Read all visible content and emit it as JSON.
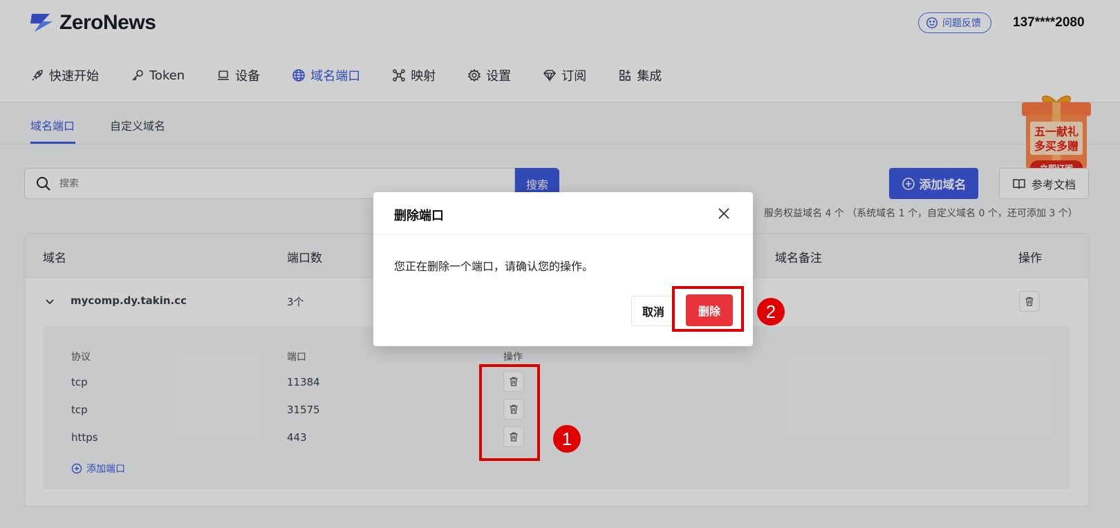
{
  "app": {
    "logo_text": "ZeroNews",
    "feedback_label": "问题反馈",
    "user_phone": "137****2080"
  },
  "nav": {
    "items": [
      {
        "label": "快速开始",
        "icon": "rocket-icon"
      },
      {
        "label": "Token",
        "icon": "key-icon"
      },
      {
        "label": "设备",
        "icon": "laptop-icon"
      },
      {
        "label": "域名端口",
        "icon": "globe-icon",
        "active": true
      },
      {
        "label": "映射",
        "icon": "network-icon"
      },
      {
        "label": "设置",
        "icon": "gear-icon"
      },
      {
        "label": "订阅",
        "icon": "diamond-icon"
      },
      {
        "label": "集成",
        "icon": "apps-icon"
      }
    ]
  },
  "subtabs": {
    "domain_ports": "域名端口",
    "custom_domain": "自定义域名"
  },
  "promo": {
    "line1": "五一献礼",
    "line2": "多买多赠",
    "cta": "立即订阅"
  },
  "toolbar": {
    "search_placeholder": "搜索",
    "search_button": "搜索",
    "add_domain": "添加域名",
    "docs": "参考文档",
    "quota": "服务权益域名 4 个 （系统域名 1 个，自定义域名 0 个，还可添加 3 个）"
  },
  "table": {
    "headers": {
      "domain": "域名",
      "port_count": "端口数",
      "note": "域名备注",
      "actions": "操作"
    },
    "row": {
      "domain": "mycomp.dy.takin.cc",
      "port_count": "3个"
    },
    "sub": {
      "headers": {
        "protocol": "协议",
        "port": "端口",
        "actions": "操作"
      },
      "ports": [
        {
          "protocol": "tcp",
          "port": "11384"
        },
        {
          "protocol": "tcp",
          "port": "31575"
        },
        {
          "protocol": "https",
          "port": "443"
        }
      ],
      "add_port": "添加端口"
    }
  },
  "modal": {
    "title": "删除端口",
    "body": "您正在删除一个端口，请确认您的操作。",
    "cancel": "取消",
    "confirm": "删除"
  },
  "annotations": {
    "step1": "1",
    "step2": "2"
  },
  "colors": {
    "primary": "#3d5ae0",
    "danger": "#e8333b",
    "annotation": "#e10000"
  }
}
